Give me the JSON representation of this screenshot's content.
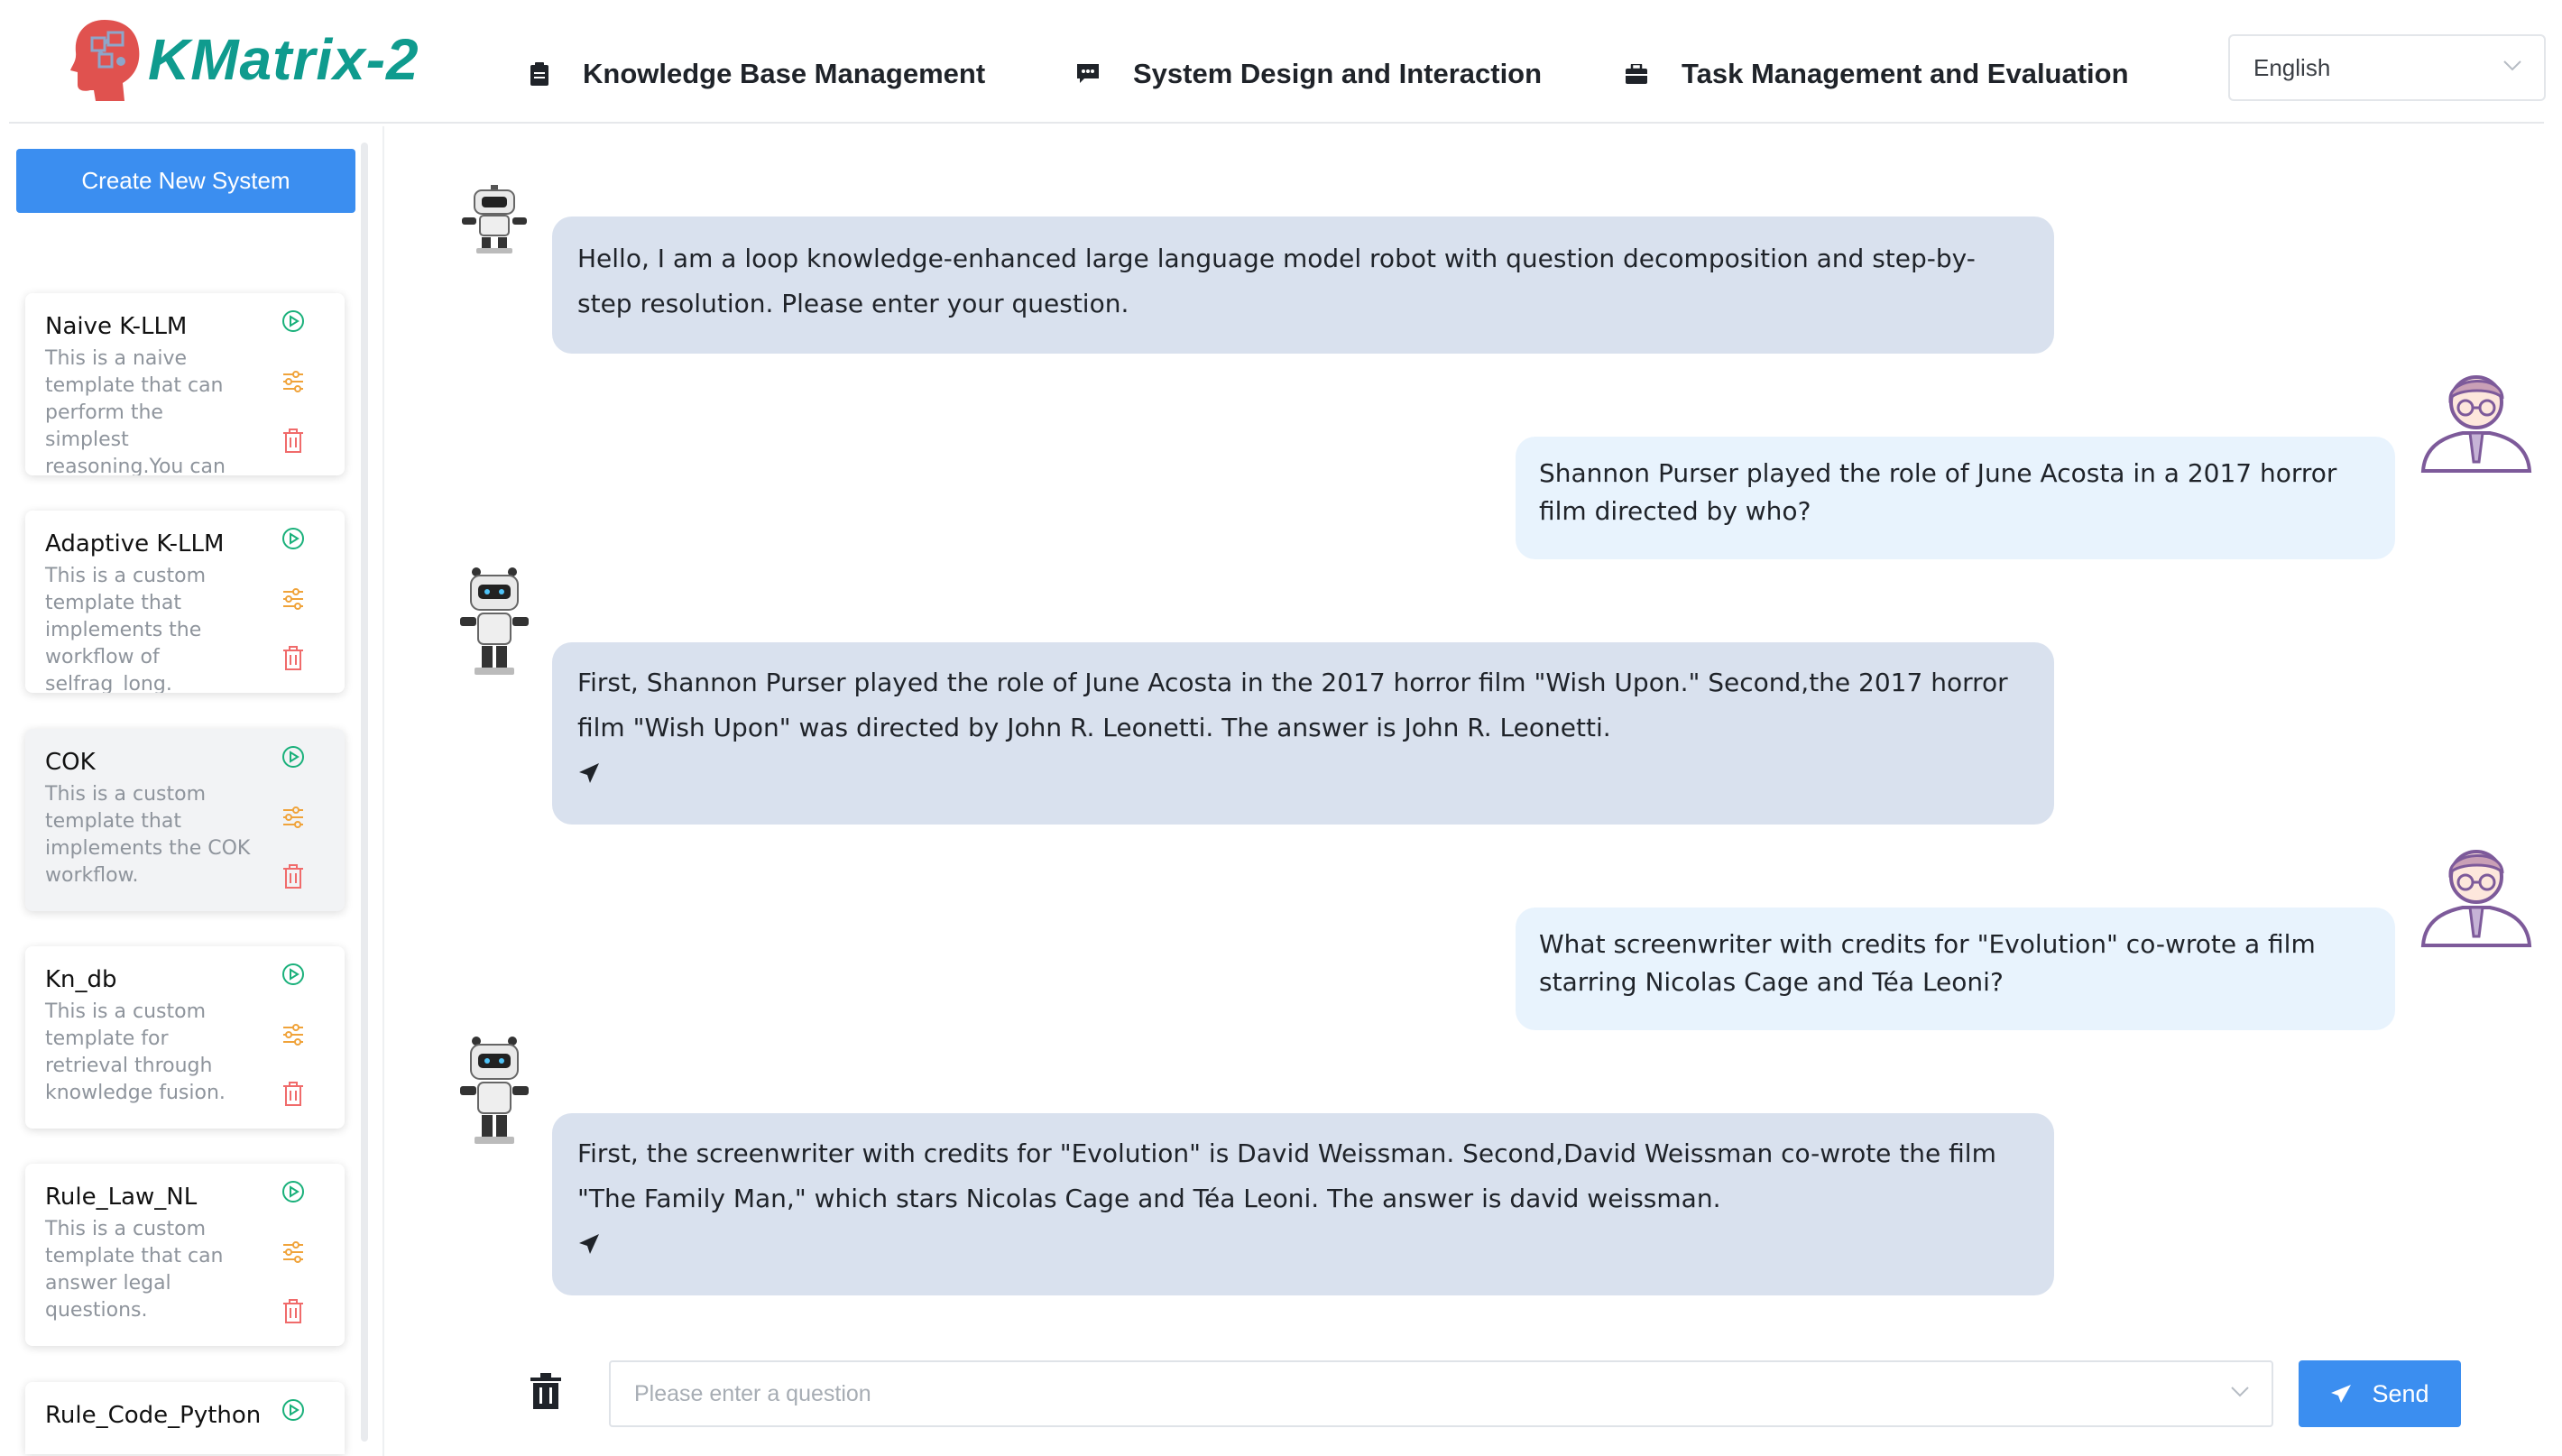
{
  "app": {
    "logo_text": "KMatrix-2",
    "accent_color": "#0f9b8e",
    "primary_color": "#3b8ef0"
  },
  "nav": {
    "items": [
      {
        "label": "Knowledge Base Management",
        "icon": "clipboard-icon"
      },
      {
        "label": "System Design and Interaction",
        "icon": "chat-bubble-icon"
      },
      {
        "label": "Task Management and Evaluation",
        "icon": "briefcase-icon"
      }
    ],
    "language": "English"
  },
  "sidebar": {
    "create_label": "Create New System",
    "systems": [
      {
        "title": "Naive K-LLM",
        "desc": "This is a naive template that can perform the simplest reasoning.You can modify it according to",
        "active": false
      },
      {
        "title": "Adaptive K-LLM",
        "desc": "This is a custom template that implements the workflow of selfrag_long.",
        "active": false
      },
      {
        "title": "COK",
        "desc": "This is a custom template that implements the COK workflow.",
        "active": true
      },
      {
        "title": "Kn_db",
        "desc": "This is a custom template for retrieval through knowledge fusion.",
        "active": false
      },
      {
        "title": "Rule_Law_NL",
        "desc": "This is a custom template that can answer legal questions.",
        "active": false
      },
      {
        "title": "Rule_Code_Python",
        "desc": "",
        "active": false
      }
    ]
  },
  "chat": {
    "messages": [
      {
        "role": "bot",
        "text": "Hello, I am a loop knowledge-enhanced large language model robot with question decomposition and step-by-step resolution. Please enter your question."
      },
      {
        "role": "user",
        "text": "Shannon Purser played the role of June Acosta in a 2017 horror film directed by who?"
      },
      {
        "role": "bot",
        "text": "First, Shannon Purser played the role of June Acosta in the 2017 horror film \"Wish Upon.\" Second,the 2017 horror film \"Wish Upon\" was directed by John R. Leonetti. The answer is John R. Leonetti."
      },
      {
        "role": "user",
        "text": "What screenwriter with credits for \"Evolution\" co-wrote a film starring Nicolas Cage and Téa Leoni?"
      },
      {
        "role": "bot",
        "text": "First, the screenwriter with credits for \"Evolution\" is David Weissman. Second,David Weissman co-wrote the film \"The Family Man,\" which stars Nicolas Cage and Téa Leoni. The answer is david weissman."
      }
    ]
  },
  "input": {
    "placeholder": "Please enter a question",
    "send_label": "Send"
  }
}
